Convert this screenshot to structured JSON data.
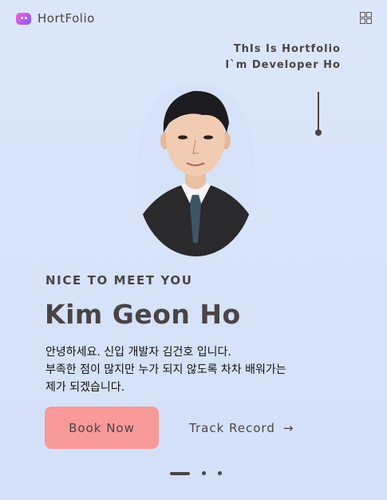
{
  "header": {
    "brand": "HortFolio",
    "logo_icon": "chat-bubble-icon",
    "menu_icon": "grid-icon"
  },
  "hero": {
    "tagline_line1": "ThIs Is Hortfolio",
    "tagline_line2": "I`m Developer Ho",
    "kicker": "NICE TO MEET YOU",
    "name": "Kim Geon Ho",
    "intro_line1": "안녕하세요. 신입 개발자 김건호 입니다.",
    "intro_line2": "부족한 점이 많지만 누가 되지 않도록 차차 배워가는",
    "intro_line3": "제가 되겠습니다."
  },
  "actions": {
    "book_label": "Book Now",
    "track_label": "Track Record",
    "track_icon": "arrow-right-icon"
  },
  "carousel": {
    "active_index": 0,
    "count": 3
  },
  "colors": {
    "background": "#dce7fb",
    "text": "#4b4446",
    "accent": "#f79a99"
  }
}
